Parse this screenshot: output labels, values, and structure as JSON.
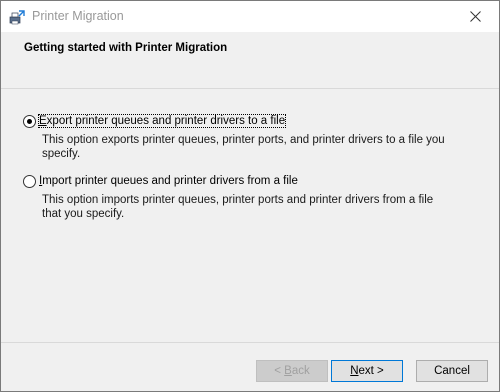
{
  "window": {
    "title": "Printer Migration",
    "close_icon": "close-icon",
    "app_icon": "printer-migration-icon"
  },
  "header": {
    "title": "Getting started with Printer Migration"
  },
  "options": [
    {
      "label_accel": "E",
      "label_rest": "xport printer queues and printer drivers to a file",
      "description": "This option exports printer queues, printer ports, and printer drivers to a file you specify.",
      "selected": true
    },
    {
      "label_accel": "I",
      "label_rest": "mport printer queues and printer drivers from a file",
      "description": "This option imports printer queues, printer ports and printer drivers from a file that you specify.",
      "selected": false
    }
  ],
  "footer": {
    "back_prefix": "< ",
    "back_accel": "B",
    "back_rest": "ack",
    "next_accel": "N",
    "next_rest": "ext >",
    "cancel_label": "Cancel"
  }
}
